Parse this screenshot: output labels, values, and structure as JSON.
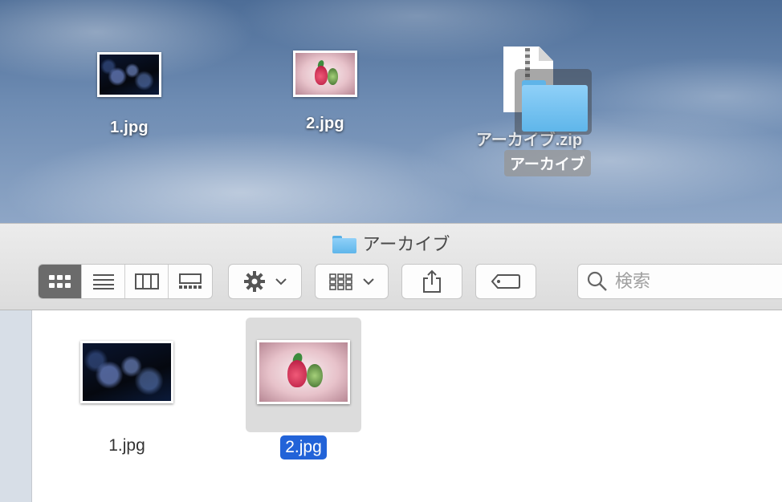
{
  "desktop": {
    "icons": [
      {
        "label": "1.jpg",
        "thumbnail": "jellyfish-photo"
      },
      {
        "label": "2.jpg",
        "thumbnail": "fruit-photo"
      },
      {
        "label": "アーカイブ.zip",
        "thumbnail": "zip-archive-icon"
      }
    ],
    "drag_ghost": {
      "label": "アーカイブ",
      "icon": "folder-icon"
    }
  },
  "window": {
    "title": "アーカイブ",
    "title_icon": "folder-icon",
    "toolbar": {
      "view_modes": [
        "icon-view-icon",
        "list-view-icon",
        "column-view-icon",
        "gallery-view-icon"
      ],
      "active_view": "icon-view-icon",
      "action_menu_icon": "gear-icon",
      "group_menu_icon": "grid-group-icon",
      "share_icon": "share-icon",
      "tag_icon": "tag-icon",
      "search": {
        "placeholder": "検索",
        "value": ""
      }
    },
    "files": [
      {
        "label": "1.jpg",
        "thumbnail": "jellyfish-photo",
        "selected": false
      },
      {
        "label": "2.jpg",
        "thumbnail": "fruit-photo",
        "selected": true
      }
    ]
  },
  "colors": {
    "selection_blue": "#2263d8",
    "folder_blue": "#6fc0f0",
    "active_segment": "#6b6b6b"
  }
}
